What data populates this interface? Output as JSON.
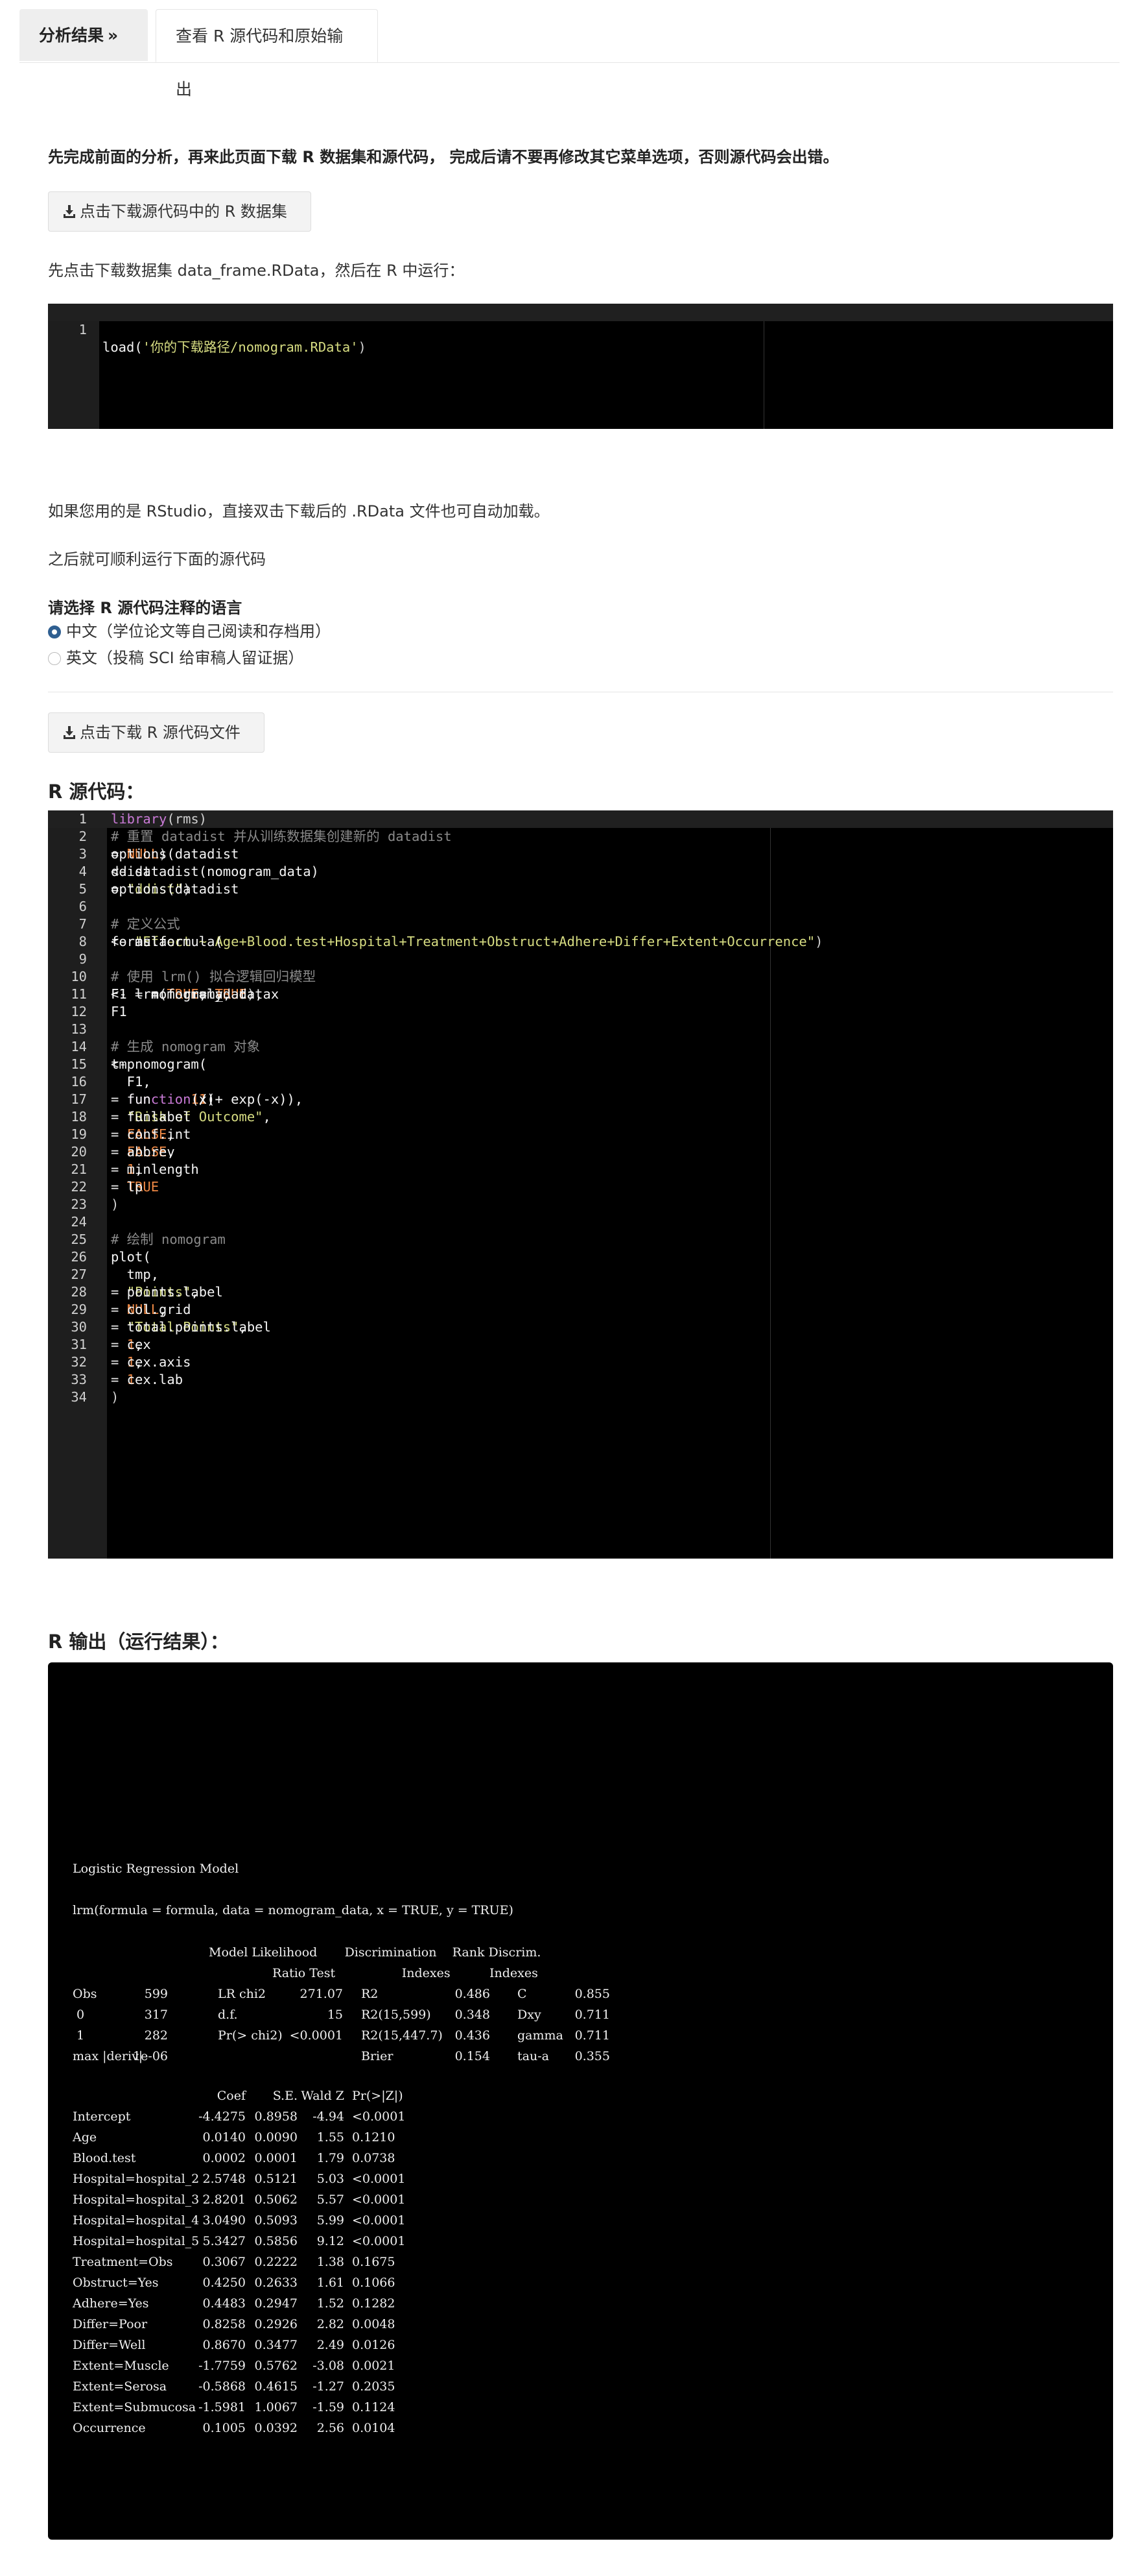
{
  "tabs": {
    "results": "分析结果",
    "source": "查看 R 源代码和原始输出"
  },
  "notice": "先完成前面的分析，再来此页面下载 R 数据集和源代码， 完成后请不要再修改其它菜单选项，否则源代码会出错。",
  "download_data_button": "点击下载源代码中的 R 数据集",
  "load_instruction": "先点击下载数据集 data_frame.RData，然后在 R 中运行：",
  "load_code": {
    "num": "1",
    "fn": "load(",
    "str": "'你的下载路径/nomogram.RData'",
    "close": ")"
  },
  "rstudio_note": "如果您用的是 RStudio，直接双击下载后的 .RData 文件也可自动加载。",
  "then_note": "之后就可顺利运行下面的源代码",
  "language_label": "请选择 R 源代码注释的语言",
  "lang_options": [
    "中文（学位论文等自己阅读和存档用）",
    "英文（投稿 SCI 给审稿人留证据）"
  ],
  "download_code_button": "点击下载 R 源代码文件",
  "source_title": "R 源代码：",
  "code_lines": [
    [
      [
        "kw",
        "library"
      ],
      [
        "pn",
        "(rms)"
      ]
    ],
    [
      [
        "cm",
        "# 重置 datadist 并从训练数据集创建新的 datadist"
      ]
    ],
    [
      [
        "tx",
        "options(datadist "
      ],
      [
        "op",
        "= "
      ],
      [
        "ct",
        "NULL"
      ],
      [
        "pn",
        ")"
      ]
    ],
    [
      [
        "tx",
        "ddist "
      ],
      [
        "op",
        "<- "
      ],
      [
        "tx",
        "datadist(nomogram_data)"
      ]
    ],
    [
      [
        "tx",
        "options(datadist "
      ],
      [
        "op",
        "= "
      ],
      [
        "st",
        "\"ddist\""
      ],
      [
        "pn",
        ")"
      ]
    ],
    [],
    [
      [
        "cm",
        "# 定义公式"
      ]
    ],
    [
      [
        "tx",
        "formula "
      ],
      [
        "op",
        "<- "
      ],
      [
        "tx",
        "as.formula("
      ],
      [
        "st",
        "\"Effect ~ Age+Blood.test+Hospital+Treatment+Obstruct+Adhere+Differ+Extent+Occurrence\""
      ],
      [
        "pn",
        ")"
      ]
    ],
    [],
    [
      [
        "cm",
        "# 使用 lrm() 拟合逻辑回归模型"
      ]
    ],
    [
      [
        "tx",
        "F1 "
      ],
      [
        "op",
        "<- "
      ],
      [
        "tx",
        "lrm(formula, data "
      ],
      [
        "op",
        "= "
      ],
      [
        "tx",
        "nomogram_data, x "
      ],
      [
        "op",
        "= "
      ],
      [
        "ct",
        "TRUE"
      ],
      [
        "tx",
        ", y "
      ],
      [
        "op",
        "= "
      ],
      [
        "ct",
        "TRUE"
      ],
      [
        "pn",
        ")"
      ]
    ],
    [
      [
        "tx",
        "F1"
      ]
    ],
    [],
    [
      [
        "cm",
        "# 生成 nomogram 对象"
      ]
    ],
    [
      [
        "tx",
        "tmp "
      ],
      [
        "op",
        "<- "
      ],
      [
        "tx",
        "nomogram("
      ]
    ],
    [
      [
        "tx",
        "  F1,"
      ]
    ],
    [
      [
        "tx",
        "  fun "
      ],
      [
        "op",
        "= "
      ],
      [
        "kw",
        "function"
      ],
      [
        "tx",
        "(x) "
      ],
      [
        "nm",
        "1"
      ],
      [
        "tx",
        "/("
      ],
      [
        "nm",
        "1"
      ],
      [
        "tx",
        " + exp(-x)),"
      ]
    ],
    [
      [
        "tx",
        "  funlabel "
      ],
      [
        "op",
        "= "
      ],
      [
        "st",
        "\"Risk of Outcome\""
      ],
      [
        "tx",
        ","
      ]
    ],
    [
      [
        "tx",
        "  conf.int "
      ],
      [
        "op",
        "= "
      ],
      [
        "ct",
        "FALSE"
      ],
      [
        "tx",
        ","
      ]
    ],
    [
      [
        "tx",
        "  abbrev "
      ],
      [
        "op",
        "= "
      ],
      [
        "ct",
        "FALSE"
      ],
      [
        "tx",
        ","
      ]
    ],
    [
      [
        "tx",
        "  minlength "
      ],
      [
        "op",
        "= "
      ],
      [
        "nm",
        "1"
      ],
      [
        "tx",
        ","
      ]
    ],
    [
      [
        "tx",
        "  lp "
      ],
      [
        "op",
        "= "
      ],
      [
        "ct",
        "TRUE"
      ]
    ],
    [
      [
        "pn",
        ")"
      ]
    ],
    [],
    [
      [
        "cm",
        "# 绘制 nomogram"
      ]
    ],
    [
      [
        "tx",
        "plot("
      ]
    ],
    [
      [
        "tx",
        "  tmp,"
      ]
    ],
    [
      [
        "tx",
        "  points.label "
      ],
      [
        "op",
        "= "
      ],
      [
        "st",
        "\"Points\""
      ],
      [
        "tx",
        ","
      ]
    ],
    [
      [
        "tx",
        "  col.grid "
      ],
      [
        "op",
        "= "
      ],
      [
        "ct",
        "NULL"
      ],
      [
        "tx",
        ","
      ]
    ],
    [
      [
        "tx",
        "  total.points.label "
      ],
      [
        "op",
        "= "
      ],
      [
        "st",
        "\"Total Points\""
      ],
      [
        "tx",
        ","
      ]
    ],
    [
      [
        "tx",
        "  cex "
      ],
      [
        "op",
        "= "
      ],
      [
        "nm",
        "1"
      ],
      [
        "tx",
        ","
      ]
    ],
    [
      [
        "tx",
        "  cex.axis "
      ],
      [
        "op",
        "= "
      ],
      [
        "nm",
        "1"
      ],
      [
        "tx",
        ","
      ]
    ],
    [
      [
        "tx",
        "  cex.lab "
      ],
      [
        "op",
        "= "
      ],
      [
        "nm",
        "1"
      ]
    ],
    [
      [
        "pn",
        ")"
      ]
    ]
  ],
  "output_title": "R 输出（运行结果）：",
  "output": {
    "model_title": "Logistic Regression Model",
    "call": "lrm(formula = formula, data = nomogram_data, x = TRUE, y = TRUE)",
    "hdr1": "Model Likelihood       Discrimination    Rank Discrim.",
    "hdr2": "Ratio Test                 Indexes          Indexes",
    "stats_rows": [
      [
        "Obs",
        "599",
        "LR chi2",
        "271.07",
        "R2",
        "0.486",
        "C",
        "0.855"
      ],
      [
        " 0",
        "317",
        "d.f.",
        "15",
        "R2(15,599)",
        "0.348",
        "Dxy",
        "0.711"
      ],
      [
        " 1",
        "282",
        "Pr(> chi2)",
        "<0.0001",
        "R2(15,447.7)",
        "0.436",
        "gamma",
        "0.711"
      ],
      [
        "max |deriv|",
        "1e-06",
        "",
        "",
        "Brier",
        "0.154",
        "tau-a",
        "0.355"
      ]
    ],
    "coef_header": [
      "Coef",
      "S.E.",
      "Wald Z",
      "Pr(>|Z|)"
    ],
    "coef_rows": [
      [
        "Intercept",
        "-4.4275",
        "0.8958",
        "-4.94",
        "<0.0001"
      ],
      [
        "Age",
        "0.0140",
        "0.0090",
        "1.55",
        "0.1210"
      ],
      [
        "Blood.test",
        "0.0002",
        "0.0001",
        "1.79",
        "0.0738"
      ],
      [
        "Hospital=hospital_2",
        "2.5748",
        "0.5121",
        "5.03",
        "<0.0001"
      ],
      [
        "Hospital=hospital_3",
        "2.8201",
        "0.5062",
        "5.57",
        "<0.0001"
      ],
      [
        "Hospital=hospital_4",
        "3.0490",
        "0.5093",
        "5.99",
        "<0.0001"
      ],
      [
        "Hospital=hospital_5",
        "5.3427",
        "0.5856",
        "9.12",
        "<0.0001"
      ],
      [
        "Treatment=Obs",
        "0.3067",
        "0.2222",
        "1.38",
        "0.1675"
      ],
      [
        "Obstruct=Yes",
        "0.4250",
        "0.2633",
        "1.61",
        "0.1066"
      ],
      [
        "Adhere=Yes",
        "0.4483",
        "0.2947",
        "1.52",
        "0.1282"
      ],
      [
        "Differ=Poor",
        "0.8258",
        "0.2926",
        "2.82",
        "0.0048"
      ],
      [
        "Differ=Well",
        "0.8670",
        "0.3477",
        "2.49",
        "0.0126"
      ],
      [
        "Extent=Muscle",
        "-1.7759",
        "0.5762",
        "-3.08",
        "0.0021"
      ],
      [
        "Extent=Serosa",
        "-0.5868",
        "0.4615",
        "-1.27",
        "0.2035"
      ],
      [
        "Extent=Submucosa",
        "-1.5981",
        "1.0067",
        "-1.59",
        "0.1124"
      ],
      [
        "Occurrence",
        "0.1005",
        "0.0392",
        "2.56",
        "0.0104"
      ]
    ]
  }
}
